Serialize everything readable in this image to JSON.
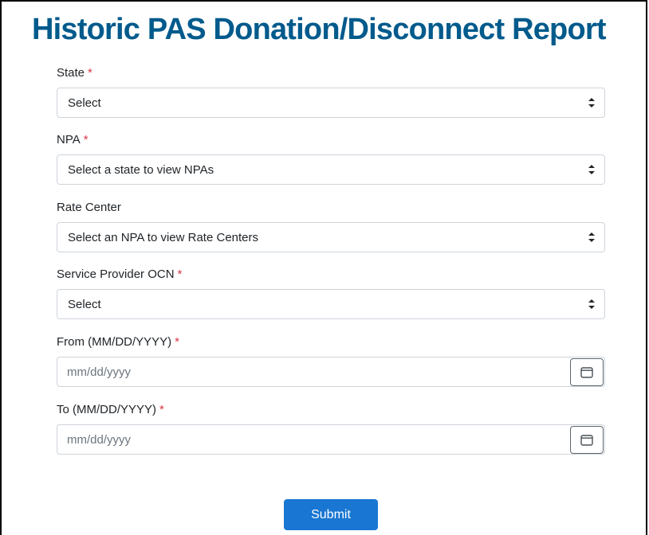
{
  "page": {
    "title": "Historic PAS Donation/Disconnect Report"
  },
  "form": {
    "required_marker": "*",
    "state": {
      "label": "State",
      "value": "Select"
    },
    "npa": {
      "label": "NPA",
      "value": "Select a state to view NPAs"
    },
    "rate_center": {
      "label": "Rate Center",
      "value": "Select an NPA to view Rate Centers"
    },
    "ocn": {
      "label": "Service Provider OCN",
      "value": "Select"
    },
    "from_date": {
      "label": "From (MM/DD/YYYY)",
      "placeholder": "mm/dd/yyyy"
    },
    "to_date": {
      "label": "To (MM/DD/YYYY)",
      "placeholder": "mm/dd/yyyy"
    },
    "submit_label": "Submit"
  },
  "icons": {
    "select_caret": "sort-caret-icon",
    "date_picker": "calendar-icon"
  },
  "colors": {
    "title": "#005a8c",
    "required": "#dc3545",
    "submit_bg": "#1976d2",
    "input_border": "#ced4da",
    "placeholder": "#6c757d"
  }
}
